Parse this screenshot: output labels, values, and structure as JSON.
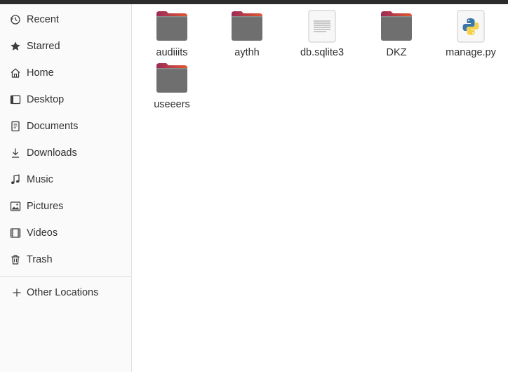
{
  "sidebar": {
    "items": [
      {
        "label": "Recent",
        "icon": "clock-icon"
      },
      {
        "label": "Starred",
        "icon": "star-icon"
      },
      {
        "label": "Home",
        "icon": "home-icon"
      },
      {
        "label": "Desktop",
        "icon": "desktop-icon"
      },
      {
        "label": "Documents",
        "icon": "document-icon"
      },
      {
        "label": "Downloads",
        "icon": "download-icon"
      },
      {
        "label": "Music",
        "icon": "music-icon"
      },
      {
        "label": "Pictures",
        "icon": "picture-icon"
      },
      {
        "label": "Videos",
        "icon": "video-icon"
      },
      {
        "label": "Trash",
        "icon": "trash-icon"
      }
    ],
    "other_locations": {
      "label": "Other Locations",
      "icon": "plus-icon"
    }
  },
  "files": [
    {
      "name": "audiiits",
      "type": "folder"
    },
    {
      "name": "aythh",
      "type": "folder"
    },
    {
      "name": "db.sqlite3",
      "type": "text-file"
    },
    {
      "name": "DKZ",
      "type": "folder"
    },
    {
      "name": "manage.py",
      "type": "python-file"
    },
    {
      "name": "useeers",
      "type": "folder"
    }
  ],
  "colors": {
    "folder_body": "#6f6f6f",
    "folder_tab_start": "#9b2a58",
    "folder_tab_end": "#e2562f",
    "sidebar_bg": "#fafafa",
    "topbar": "#2c2c2c"
  }
}
